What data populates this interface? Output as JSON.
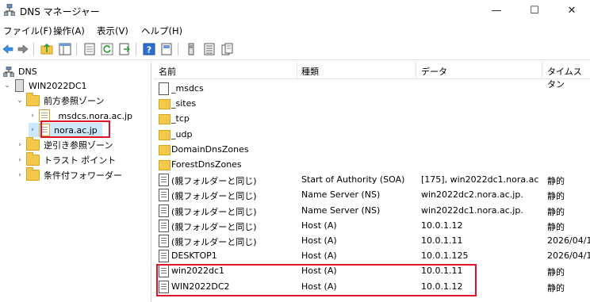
{
  "window": {
    "title": "DNS マネージャー",
    "minimize_glyph": "—",
    "maximize_glyph": "☐",
    "close_glyph": "✕"
  },
  "menu": [
    "ファイル(F)",
    "操作(A)",
    "表示(V)",
    "ヘルプ(H)"
  ],
  "toolbar_icons": [
    "back-arrow-icon",
    "forward-arrow-icon",
    "up-folder-icon",
    "show-tree-icon",
    "properties-icon",
    "refresh-icon",
    "export-icon",
    "help-icon",
    "pane-icon",
    "list-icon",
    "copy-icon"
  ],
  "tree": {
    "root": "DNS",
    "server": "WIN2022DC1",
    "forward_zones": "前方参照ゾーン",
    "zone_msdcs": "_msdcs.nora.ac.jp",
    "zone_nora": "nora.ac.jp",
    "reverse_zones": "逆引き参照ゾーン",
    "trust_points": "トラスト ポイント",
    "conditional_forwarders": "条件付フォワーダー"
  },
  "columns": {
    "name": "名前",
    "type": "種類",
    "data": "データ",
    "timestamp": "タイムスタン"
  },
  "records": [
    {
      "name": "_msdcs",
      "type": "",
      "data": "",
      "time": "",
      "icon": "doc"
    },
    {
      "name": "_sites",
      "type": "",
      "data": "",
      "time": "",
      "icon": "folder"
    },
    {
      "name": "_tcp",
      "type": "",
      "data": "",
      "time": "",
      "icon": "folder"
    },
    {
      "name": "_udp",
      "type": "",
      "data": "",
      "time": "",
      "icon": "folder"
    },
    {
      "name": "DomainDnsZones",
      "type": "",
      "data": "",
      "time": "",
      "icon": "folder"
    },
    {
      "name": "ForestDnsZones",
      "type": "",
      "data": "",
      "time": "",
      "icon": "folder"
    },
    {
      "name": "(親フォルダーと同じ)",
      "type": "Start of Authority (SOA)",
      "data": "[175], win2022dc1.nora.ac...",
      "time": "静的",
      "icon": "rec"
    },
    {
      "name": "(親フォルダーと同じ)",
      "type": "Name Server (NS)",
      "data": "win2022dc2.nora.ac.jp.",
      "time": "静的",
      "icon": "rec"
    },
    {
      "name": "(親フォルダーと同じ)",
      "type": "Name Server (NS)",
      "data": "win2022dc1.nora.ac.jp.",
      "time": "静的",
      "icon": "rec"
    },
    {
      "name": "(親フォルダーと同じ)",
      "type": "Host (A)",
      "data": "10.0.1.12",
      "time": "静的",
      "icon": "rec"
    },
    {
      "name": "(親フォルダーと同じ)",
      "type": "Host (A)",
      "data": "10.0.1.11",
      "time": "2026/04/1",
      "icon": "rec"
    },
    {
      "name": "DESKTOP1",
      "type": "Host (A)",
      "data": "10.0.1.125",
      "time": "2026/04/1",
      "icon": "rec"
    },
    {
      "name": "win2022dc1",
      "type": "Host (A)",
      "data": "10.0.1.11",
      "time": "静的",
      "icon": "rec"
    },
    {
      "name": "WIN2022DC2",
      "type": "Host (A)",
      "data": "10.0.1.12",
      "time": "静的",
      "icon": "rec"
    }
  ],
  "colors": {
    "highlight_border": "#e0142b",
    "selected_bg": "#cce8ff",
    "folder": "#f4c84a"
  }
}
